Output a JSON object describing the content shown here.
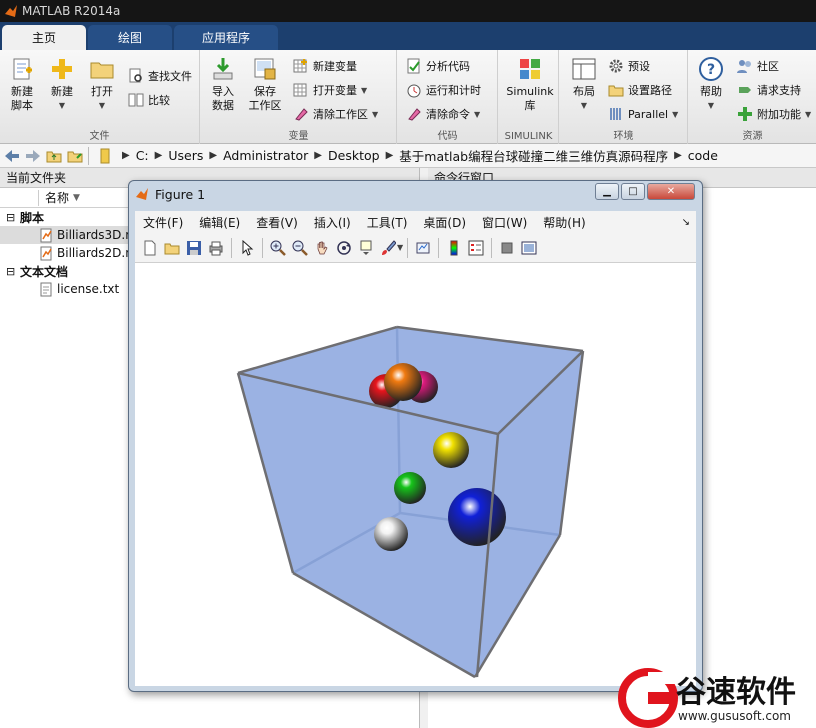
{
  "app": {
    "title": "MATLAB R2014a"
  },
  "tabs": [
    {
      "label": "主页",
      "active": true
    },
    {
      "label": "绘图",
      "active": false
    },
    {
      "label": "应用程序",
      "active": false
    }
  ],
  "ribbon": {
    "file": {
      "label": "文件",
      "new_script": "新建\n脚本",
      "new": "新建",
      "open": "打开",
      "find_files": "查找文件",
      "compare": "比较"
    },
    "variable": {
      "label": "变量",
      "import": "导入\n数据",
      "save_workspace": "保存\n工作区",
      "new_variable": "新建变量",
      "open_variable": "打开变量",
      "clear_workspace": "清除工作区"
    },
    "code": {
      "label": "代码",
      "analyze": "分析代码",
      "run_time": "运行和计时",
      "clear_commands": "清除命令"
    },
    "simulink": {
      "label": "SIMULINK",
      "library": "Simulink\n库"
    },
    "environment": {
      "label": "环境",
      "layout": "布局",
      "preferences": "预设",
      "set_path": "设置路径",
      "parallel": "Parallel"
    },
    "resources": {
      "label": "资源",
      "help": "帮助",
      "community": "社区",
      "support": "请求支持",
      "addons": "附加功能"
    }
  },
  "address": {
    "crumbs": [
      "C:",
      "Users",
      "Administrator",
      "Desktop",
      "基于matlab编程台球碰撞二维三维仿真源码程序",
      "code"
    ]
  },
  "left_panel": {
    "title": "当前文件夹",
    "column_name": "名称",
    "sections": [
      {
        "label": "脚本",
        "items": [
          "Billiards3D.m",
          "Billiards2D.m"
        ]
      },
      {
        "label": "文本文档",
        "items": [
          "license.txt"
        ]
      }
    ]
  },
  "right_panel": {
    "title": "命令行窗口"
  },
  "figure": {
    "title": "Figure 1",
    "menus": [
      "文件(F)",
      "编辑(E)",
      "查看(V)",
      "插入(I)",
      "工具(T)",
      "桌面(D)",
      "窗口(W)",
      "帮助(H)"
    ],
    "balls": [
      {
        "name": "red-ball",
        "color": "#e8141c"
      },
      {
        "name": "magenta-ball",
        "color": "#e01a7f"
      },
      {
        "name": "orange-ball",
        "color": "#f07a10"
      },
      {
        "name": "yellow-ball",
        "color": "#f2e200"
      },
      {
        "name": "green-ball",
        "color": "#16c41a"
      },
      {
        "name": "blue-ball",
        "color": "#1020d8"
      },
      {
        "name": "white-ball",
        "color": "#f2f2f2"
      }
    ],
    "cube_color": "#8aa5de"
  },
  "watermark": {
    "cn": "谷速软件",
    "url": "www.gususoft.com"
  }
}
